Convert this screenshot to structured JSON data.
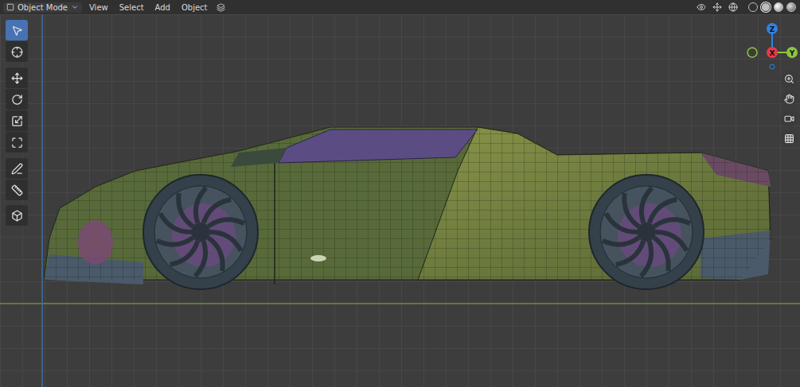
{
  "header": {
    "mode": "Object Mode",
    "menus": [
      "View",
      "Select",
      "Add",
      "Object"
    ]
  },
  "tools": [
    {
      "kind": "select",
      "selected": true
    },
    {
      "kind": "cursor",
      "selected": false
    },
    {
      "kind": "move",
      "selected": false
    },
    {
      "kind": "rotate",
      "selected": false
    },
    {
      "kind": "scale",
      "selected": false
    },
    {
      "kind": "transform",
      "selected": false
    },
    {
      "kind": "annotate",
      "selected": false
    },
    {
      "kind": "measure",
      "selected": false
    },
    {
      "kind": "add",
      "selected": false
    }
  ],
  "shading": [
    {
      "kind": "wireframe",
      "selected": false
    },
    {
      "kind": "solid",
      "selected": true
    },
    {
      "kind": "material",
      "selected": false
    },
    {
      "kind": "rendered",
      "selected": false
    }
  ],
  "gizmo": {
    "axes": [
      {
        "label": "Z",
        "color": "#2f83e3"
      },
      {
        "label": "X",
        "color": "#e8394f"
      },
      {
        "label": "Y",
        "color": "#8bc53f"
      }
    ]
  },
  "navigation": [
    {
      "kind": "zoom"
    },
    {
      "kind": "pan"
    },
    {
      "kind": "camera"
    },
    {
      "kind": "perspective"
    }
  ]
}
